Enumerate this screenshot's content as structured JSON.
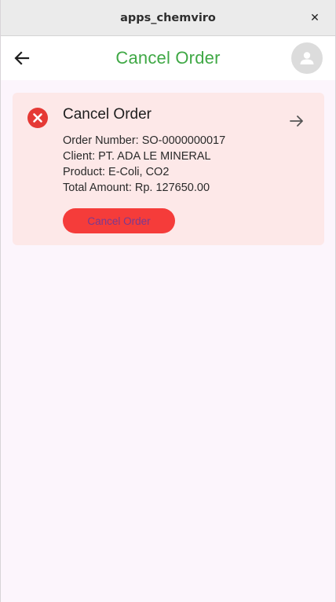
{
  "window": {
    "title": "apps_chemviro",
    "close_glyph": "✕"
  },
  "appbar": {
    "title": "Cancel Order",
    "back_icon": "arrow-left-icon",
    "avatar_icon": "person-icon"
  },
  "card": {
    "title": "Cancel Order",
    "status_icon": "cancel-circle-icon",
    "arrow_icon": "arrow-right-icon",
    "order_number": "Order Number: SO-0000000017",
    "client": "Client: PT. ADA LE MINERAL",
    "product": "Product: E-Coli, CO2",
    "total_amount": "Total Amount: Rp. 127650.00",
    "button_label": "Cancel Order"
  },
  "colors": {
    "accent_green": "#3fa845",
    "card_background": "#fde8e8",
    "danger_red": "#f53c3a",
    "button_text": "#7a3a90",
    "page_background": "#fcf5fc"
  }
}
